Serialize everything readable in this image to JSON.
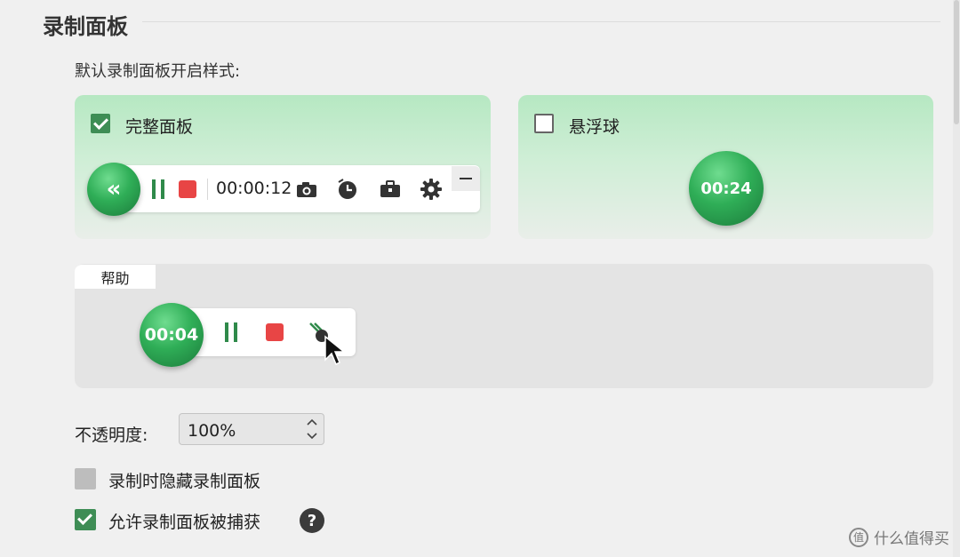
{
  "section": {
    "title": "录制面板"
  },
  "default_style": {
    "label": "默认录制面板开启样式:",
    "full_panel": {
      "label": "完整面板",
      "checked": true,
      "collapse_icon": "«",
      "timer": "00:00:12",
      "tools": [
        "pause-icon",
        "stop-icon",
        "camera-icon",
        "schedule-icon",
        "toolbox-icon",
        "gear-icon"
      ]
    },
    "float_ball": {
      "label": "悬浮球",
      "checked": false,
      "timer": "00:24"
    }
  },
  "help": {
    "tab_label": "帮助",
    "timer": "00:04",
    "tools": [
      "pause-icon",
      "stop-icon",
      "pen-icon",
      "cursor-icon"
    ]
  },
  "opacity": {
    "label": "不透明度:",
    "value": "100%"
  },
  "options": {
    "hide_panel": {
      "label": "录制时隐藏录制面板",
      "checked": false,
      "disabled": true
    },
    "allow_capture": {
      "label": "允许录制面板被捕获",
      "checked": true
    }
  },
  "help_icon": "?",
  "watermark": {
    "logo": "值",
    "text": "什么值得买"
  },
  "colors": {
    "accent_green": "#3e8d55",
    "stop_red": "#e84545",
    "card_green": "#b6e8c2"
  }
}
